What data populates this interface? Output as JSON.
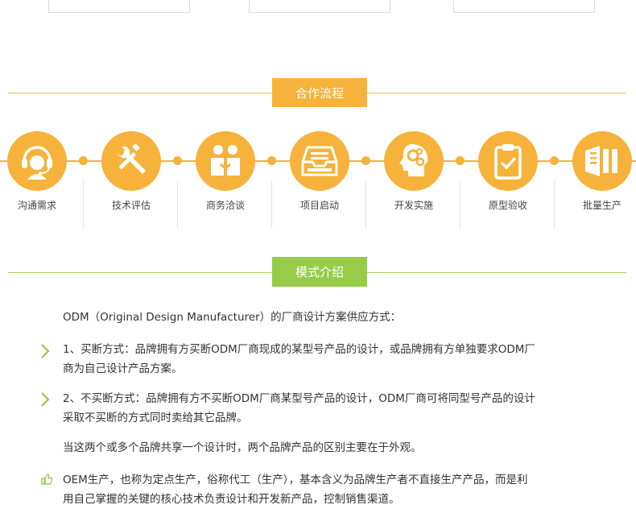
{
  "sections": {
    "process_title": "合作流程",
    "mode_title": "模式介绍"
  },
  "process": {
    "steps": [
      {
        "label": "沟通需求",
        "icon": "headset-agent-icon"
      },
      {
        "label": "技术评估",
        "icon": "wrench-screwdriver-icon"
      },
      {
        "label": "商务洽谈",
        "icon": "handshake-people-icon"
      },
      {
        "label": "项目启动",
        "icon": "inbox-tray-icon"
      },
      {
        "label": "开发实施",
        "icon": "head-gears-icon"
      },
      {
        "label": "原型验收",
        "icon": "clipboard-check-icon"
      },
      {
        "label": "批量生产",
        "icon": "document-stack-icon"
      }
    ]
  },
  "content": {
    "intro": "ODM（Original Design Manufacturer）的厂商设计方案供应方式：",
    "item1_line1": "1、买断方式：品牌拥有方买断ODM厂商现成的某型号产品的设计，或品牌拥有方单独要求ODM厂",
    "item1_line2": "商为自己设计产品方案。",
    "item2_line1": "2、不买断方式：品牌拥有方不买断ODM厂商某型号产品的设计，ODM厂商可将同型号产品的设计",
    "item2_line2": "采取不买断的方式同时卖给其它品牌。",
    "shared": "当这两个或多个品牌共享一个设计时，两个品牌产品的区别主要在于外观。",
    "oem_line1": "OEM生产，也称为定点生产，俗称代工（生产），基本含义为品牌生产者不直接生产产品，而是利",
    "oem_line2": "用自己掌握的关键的核心技术负责设计和开发新产品，控制销售渠道。"
  },
  "colors": {
    "orange": "#f6b23a",
    "green": "#96cc4a",
    "arrow_green": "#8cc63f"
  }
}
